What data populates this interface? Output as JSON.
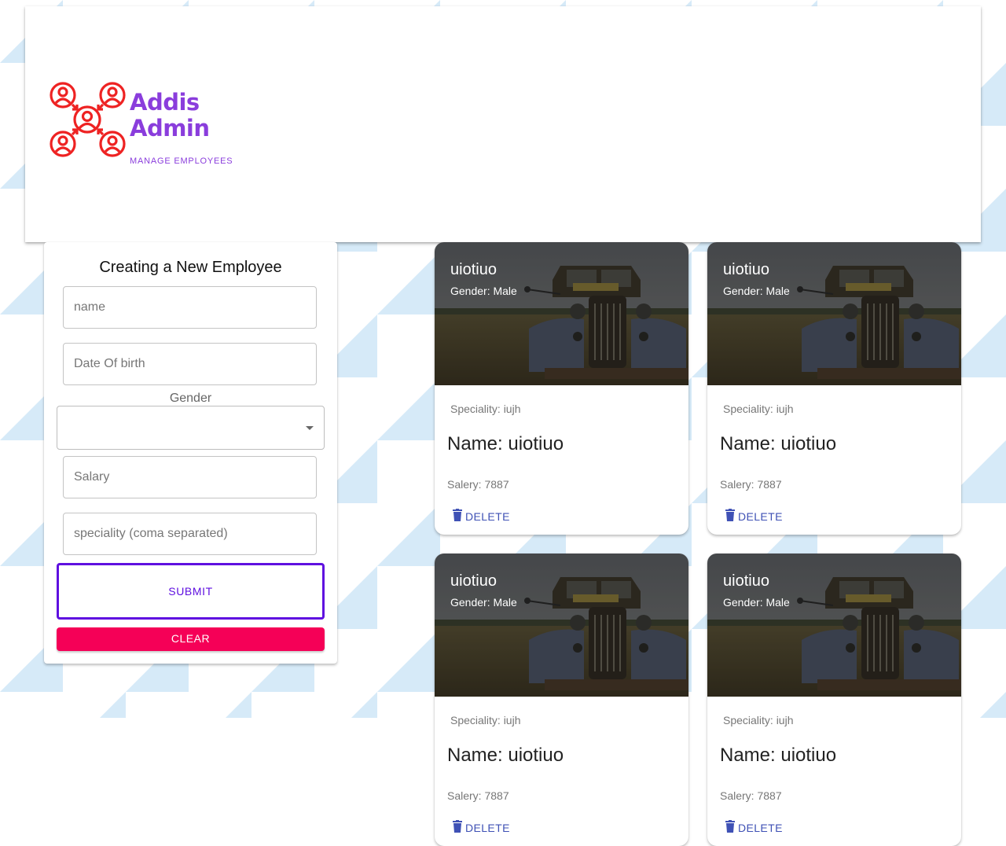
{
  "brand": {
    "line1": "Addis",
    "line2": "Admin",
    "tagline": "MANAGE EMPLOYEES",
    "icon": "people-network-icon",
    "colors": {
      "wordmark": "#8a3ddc",
      "icon": "#ee2222"
    }
  },
  "form": {
    "title": "Creating a New Employee",
    "name_placeholder": "name",
    "dob_placeholder": "Date Of birth",
    "gender_label": "Gender",
    "gender_value": "",
    "salary_placeholder": "Salary",
    "speciality_placeholder": "speciality (coma separated)",
    "submit_label": "SUBMIT",
    "clear_label": "CLEAR",
    "colors": {
      "submit": "#5f10e0",
      "clear": "#f50057"
    }
  },
  "employees": [
    {
      "name": "uiotiuo",
      "gender": "Gender: Male",
      "speciality": "Speciality: iujh",
      "full_name": "Name: uiotiuo",
      "salary": "Salery: 7887",
      "delete_label": "DELETE"
    },
    {
      "name": "uiotiuo",
      "gender": "Gender: Male",
      "speciality": "Speciality: iujh",
      "full_name": "Name: uiotiuo",
      "salary": "Salery: 7887",
      "delete_label": "DELETE"
    },
    {
      "name": "uiotiuo",
      "gender": "Gender: Male",
      "speciality": "Speciality: iujh",
      "full_name": "Name: uiotiuo",
      "salary": "Salery: 7887",
      "delete_label": "DELETE"
    },
    {
      "name": "uiotiuo",
      "gender": "Gender: Male",
      "speciality": "Speciality: iujh",
      "full_name": "Name: uiotiuo",
      "salary": "Salery: 7887",
      "delete_label": "DELETE"
    }
  ],
  "theme": {
    "accent": "#3f51b5",
    "background_pattern": "#d6eaf8"
  }
}
